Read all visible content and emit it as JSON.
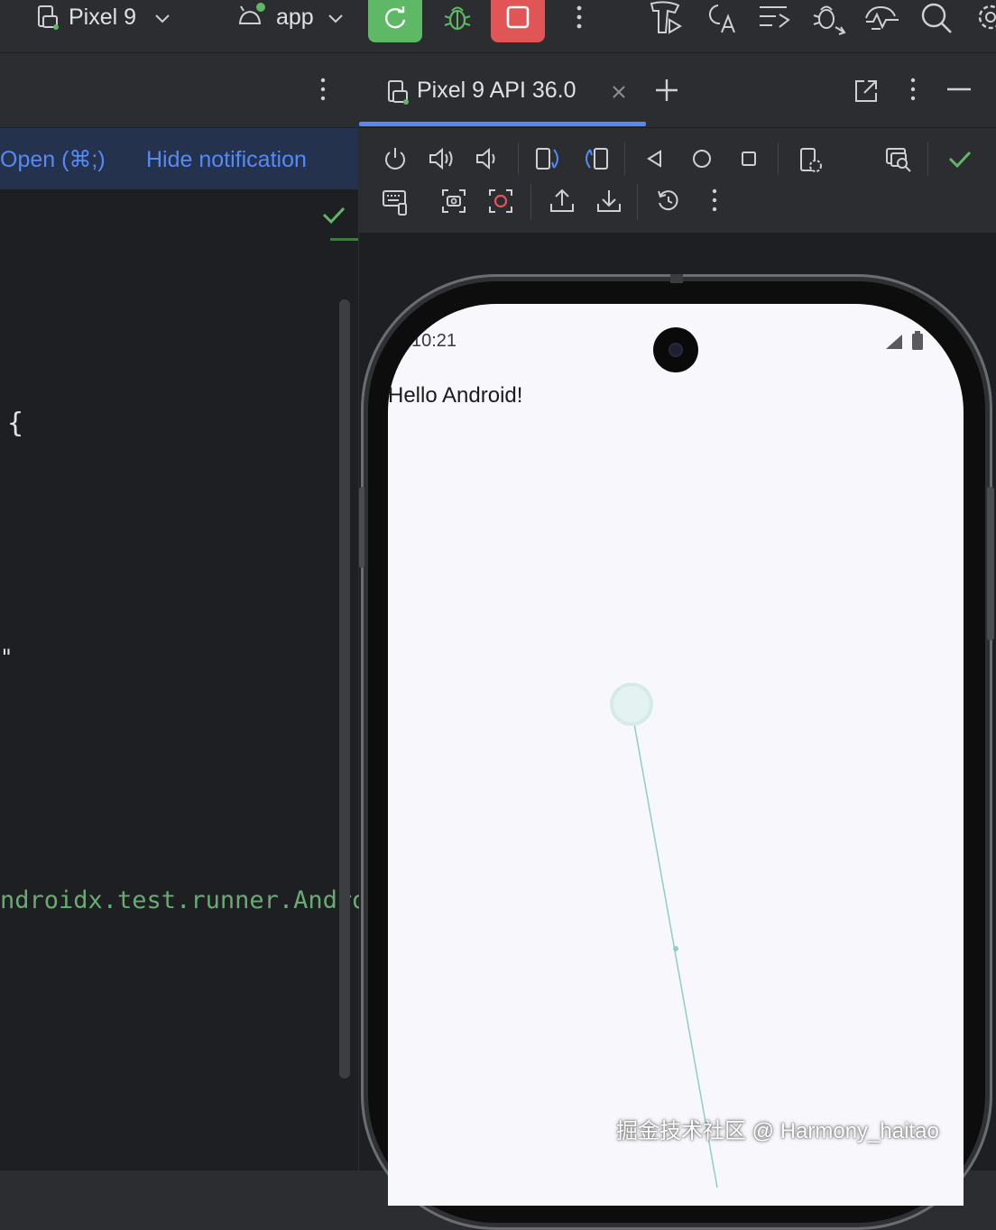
{
  "toolbar": {
    "device_selector": "Pixel 9",
    "run_config": "app"
  },
  "left_panel": {
    "notification": {
      "open_link": "Open (⌘;)",
      "hide_link": "Hide notification"
    },
    "code_lines": [
      {
        "text": "{",
        "color": "#dfe1e5"
      },
      {
        "text": "\"",
        "color": "#dfe1e5"
      },
      {
        "text": "ndroidx.test.runner.Androi",
        "color": "#6aab73"
      }
    ]
  },
  "running_devices": {
    "tab_label": "Pixel 9 API 36.0"
  },
  "emulator": {
    "status_time": "10:21",
    "app_text": "Hello Android!"
  },
  "watermark": "掘金技术社区 @ Harmony_haitao",
  "colors": {
    "accent_blue": "#548af7",
    "run_green": "#5fb865",
    "stop_red": "#e05555",
    "check_green": "#5fb865",
    "code_string_green": "#6aab73"
  }
}
